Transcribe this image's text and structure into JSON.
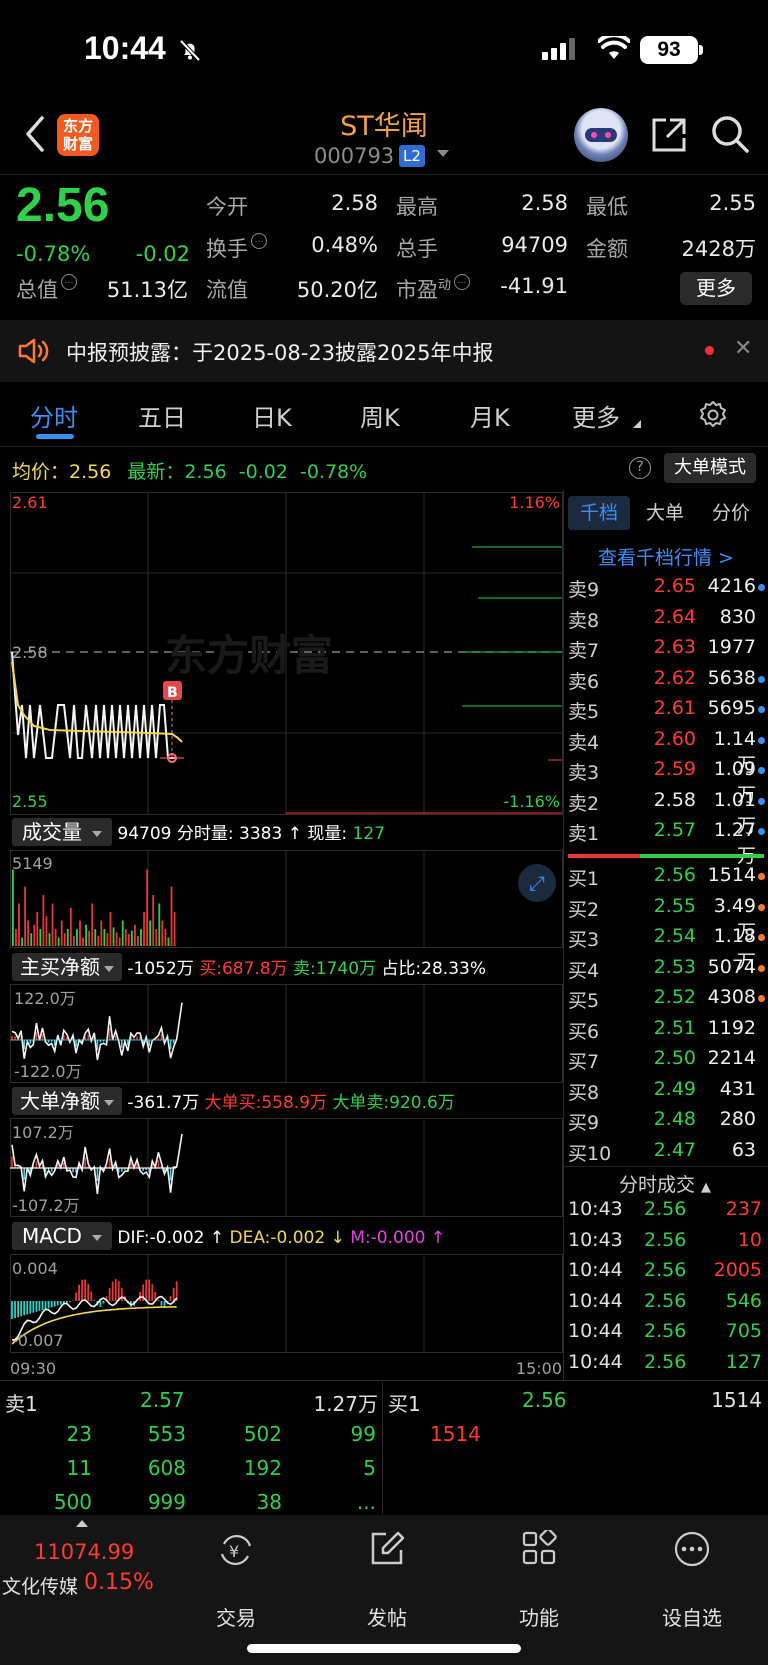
{
  "status_bar": {
    "time": "10:44",
    "battery": "93"
  },
  "header": {
    "logo_text": "东方财富",
    "stock_name": "ST华闻",
    "stock_code": "000793",
    "level_badge": "L2"
  },
  "quote": {
    "price": "2.56",
    "change_pct": "-0.78%",
    "change": "-0.02",
    "fields": [
      {
        "label": "今开",
        "value": "2.58",
        "color": "#eaeaea"
      },
      {
        "label": "最高",
        "value": "2.58",
        "color": "#eaeaea"
      },
      {
        "label": "最低",
        "value": "2.55",
        "color": "#2fd14a"
      },
      {
        "label": "换手",
        "value": "0.48%",
        "color": "#eaeaea"
      },
      {
        "label": "总手",
        "value": "94709",
        "color": "#eaeaea"
      },
      {
        "label": "金额",
        "value": "2428万",
        "color": "#eaeaea"
      },
      {
        "label": "总值",
        "value": "51.13亿",
        "color": "#eaeaea"
      },
      {
        "label": "流值",
        "value": "50.20亿",
        "color": "#eaeaea"
      },
      {
        "label": "市盈",
        "label_sup": "动",
        "value": "-41.91",
        "color": "#eaeaea"
      }
    ],
    "more_label": "更多"
  },
  "notice": {
    "text": "中报预披露：于2025-08-23披露2025年中报",
    "close": "✕"
  },
  "tabs": [
    "分时",
    "五日",
    "日K",
    "周K",
    "月K",
    "更多"
  ],
  "info_row": {
    "avg_label": "均价：",
    "avg_value": "2.56",
    "latest_label": "最新：",
    "latest_value": "2.56",
    "latest_change": "-0.02",
    "latest_pct": "-0.78%",
    "help": "?",
    "mode_btn": "大单模式"
  },
  "price_chart": {
    "y_top": "2.61",
    "y_mid": "2.58",
    "y_bottom": "2.55",
    "pct_top": "1.16%",
    "pct_bottom": "-1.16%",
    "watermark": "东方财富",
    "marker": "B"
  },
  "volume_panel": {
    "dropdown": "成交量",
    "total": "94709",
    "detail_label": "分时量:",
    "detail_value": "3383",
    "now_label": "现量:",
    "now_value": "127",
    "y_max": "5149"
  },
  "main_net_panel": {
    "dropdown": "主买净额",
    "value": "-1052万",
    "buy": "买:687.8万",
    "sell": "卖:1740万",
    "ratio": "占比:28.33%",
    "y_top": "122.0万",
    "y_bottom": "-122.0万"
  },
  "big_net_panel": {
    "dropdown": "大单净额",
    "value": "-361.7万",
    "buy": "大单买:558.9万",
    "sell": "大单卖:920.6万",
    "y_top": "107.2万",
    "y_bottom": "-107.2万"
  },
  "macd_panel": {
    "dropdown": "MACD",
    "dif": "DIF:-0.002",
    "dea": "DEA:-0.002",
    "m": "M:-0.000",
    "y_top": "0.004",
    "y_bottom": "-0.007"
  },
  "x_axis": {
    "start": "09:30",
    "end": "15:00"
  },
  "order_book": {
    "tabs": [
      "千档",
      "大单",
      "分价"
    ],
    "link": "查看千档行情 >",
    "asks": [
      {
        "label": "卖9",
        "price": "2.65",
        "volume": "4216",
        "price_color": "#ff3b30",
        "dot": "#3a8ef6"
      },
      {
        "label": "卖8",
        "price": "2.64",
        "volume": "830",
        "price_color": "#ff3b30",
        "dot": ""
      },
      {
        "label": "卖7",
        "price": "2.63",
        "volume": "1977",
        "price_color": "#ff3b30",
        "dot": ""
      },
      {
        "label": "卖6",
        "price": "2.62",
        "volume": "5638",
        "price_color": "#ff3b30",
        "dot": "#3a8ef6"
      },
      {
        "label": "卖5",
        "price": "2.61",
        "volume": "5695",
        "price_color": "#ff3b30",
        "dot": "#3a8ef6"
      },
      {
        "label": "卖4",
        "price": "2.60",
        "volume": "1.14万",
        "price_color": "#ff3b30",
        "dot": "#3a8ef6"
      },
      {
        "label": "卖3",
        "price": "2.59",
        "volume": "1.09万",
        "price_color": "#ff3b30",
        "dot": "#3a8ef6"
      },
      {
        "label": "卖2",
        "price": "2.58",
        "volume": "1.01万",
        "price_color": "#eaeaea",
        "dot": "#3a8ef6"
      },
      {
        "label": "卖1",
        "price": "2.57",
        "volume": "1.27万",
        "price_color": "#2fd14a",
        "dot": "#3a8ef6"
      }
    ],
    "bids": [
      {
        "label": "买1",
        "price": "2.56",
        "volume": "1514",
        "price_color": "#2fd14a",
        "dot": "#ff7a2e"
      },
      {
        "label": "买2",
        "price": "2.55",
        "volume": "3.49万",
        "price_color": "#2fd14a",
        "dot": "#ff7a2e"
      },
      {
        "label": "买3",
        "price": "2.54",
        "volume": "1.18万",
        "price_color": "#2fd14a",
        "dot": "#ff7a2e"
      },
      {
        "label": "买4",
        "price": "2.53",
        "volume": "5074",
        "price_color": "#2fd14a",
        "dot": "#ff7a2e"
      },
      {
        "label": "买5",
        "price": "2.52",
        "volume": "4308",
        "price_color": "#2fd14a",
        "dot": "#ff7a2e"
      },
      {
        "label": "买6",
        "price": "2.51",
        "volume": "1192",
        "price_color": "#2fd14a",
        "dot": ""
      },
      {
        "label": "买7",
        "price": "2.50",
        "volume": "2214",
        "price_color": "#2fd14a",
        "dot": ""
      },
      {
        "label": "买8",
        "price": "2.49",
        "volume": "431",
        "price_color": "#2fd14a",
        "dot": ""
      },
      {
        "label": "买9",
        "price": "2.48",
        "volume": "280",
        "price_color": "#2fd14a",
        "dot": ""
      },
      {
        "label": "买10",
        "price": "2.47",
        "volume": "63",
        "price_color": "#2fd14a",
        "dot": ""
      }
    ],
    "ticks_title": "分时成交",
    "ticks": [
      {
        "time": "10:43",
        "price": "2.56",
        "volume": "237",
        "color": "#ff3b30"
      },
      {
        "time": "10:43",
        "price": "2.56",
        "volume": "10",
        "color": "#ff3b30"
      },
      {
        "time": "10:44",
        "price": "2.56",
        "volume": "2005",
        "color": "#ff3b30"
      },
      {
        "time": "10:44",
        "price": "2.56",
        "volume": "546",
        "color": "#2fd14a"
      },
      {
        "time": "10:44",
        "price": "2.56",
        "volume": "705",
        "color": "#2fd14a"
      },
      {
        "time": "10:44",
        "price": "2.56",
        "volume": "127",
        "color": "#2fd14a"
      }
    ]
  },
  "level1": {
    "sell_label": "卖1",
    "sell_price": "2.57",
    "sell_volume": "1.27万",
    "buy_label": "买1",
    "buy_price": "2.56",
    "buy_volume": "1514",
    "sell_queue": [
      [
        "23",
        "553",
        "502",
        "99"
      ],
      [
        "11",
        "608",
        "192",
        "5"
      ],
      [
        "500",
        "999",
        "38",
        "..."
      ]
    ],
    "buy_queue": [
      "1514"
    ]
  },
  "bottom_nav": {
    "index_value": "11074.99",
    "index_name": "文化传媒",
    "index_pct": "0.15%",
    "items": [
      "交易",
      "发帖",
      "功能",
      "设自选"
    ]
  }
}
